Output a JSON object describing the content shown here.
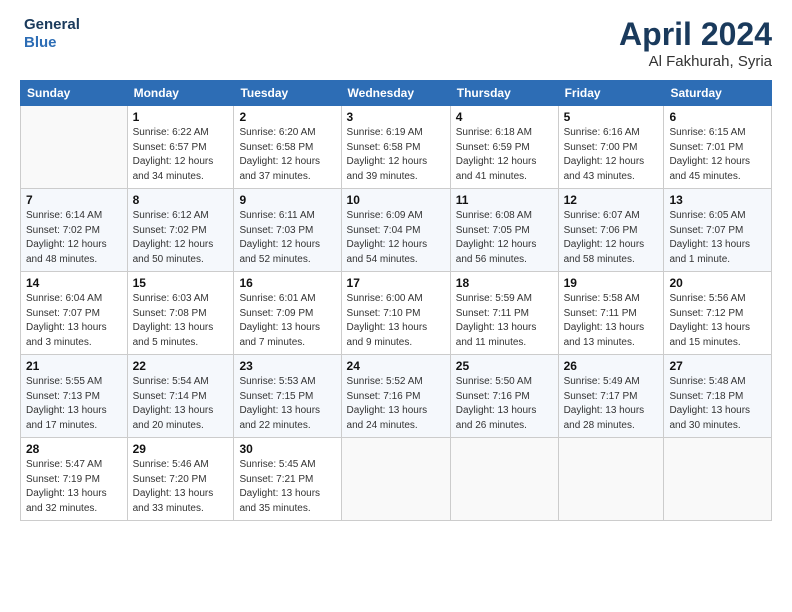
{
  "header": {
    "logo_line1": "General",
    "logo_line2": "Blue",
    "month_year": "April 2024",
    "location": "Al Fakhurah, Syria"
  },
  "columns": [
    "Sunday",
    "Monday",
    "Tuesday",
    "Wednesday",
    "Thursday",
    "Friday",
    "Saturday"
  ],
  "weeks": [
    [
      {
        "num": "",
        "info": ""
      },
      {
        "num": "1",
        "info": "Sunrise: 6:22 AM\nSunset: 6:57 PM\nDaylight: 12 hours\nand 34 minutes."
      },
      {
        "num": "2",
        "info": "Sunrise: 6:20 AM\nSunset: 6:58 PM\nDaylight: 12 hours\nand 37 minutes."
      },
      {
        "num": "3",
        "info": "Sunrise: 6:19 AM\nSunset: 6:58 PM\nDaylight: 12 hours\nand 39 minutes."
      },
      {
        "num": "4",
        "info": "Sunrise: 6:18 AM\nSunset: 6:59 PM\nDaylight: 12 hours\nand 41 minutes."
      },
      {
        "num": "5",
        "info": "Sunrise: 6:16 AM\nSunset: 7:00 PM\nDaylight: 12 hours\nand 43 minutes."
      },
      {
        "num": "6",
        "info": "Sunrise: 6:15 AM\nSunset: 7:01 PM\nDaylight: 12 hours\nand 45 minutes."
      }
    ],
    [
      {
        "num": "7",
        "info": "Sunrise: 6:14 AM\nSunset: 7:02 PM\nDaylight: 12 hours\nand 48 minutes."
      },
      {
        "num": "8",
        "info": "Sunrise: 6:12 AM\nSunset: 7:02 PM\nDaylight: 12 hours\nand 50 minutes."
      },
      {
        "num": "9",
        "info": "Sunrise: 6:11 AM\nSunset: 7:03 PM\nDaylight: 12 hours\nand 52 minutes."
      },
      {
        "num": "10",
        "info": "Sunrise: 6:09 AM\nSunset: 7:04 PM\nDaylight: 12 hours\nand 54 minutes."
      },
      {
        "num": "11",
        "info": "Sunrise: 6:08 AM\nSunset: 7:05 PM\nDaylight: 12 hours\nand 56 minutes."
      },
      {
        "num": "12",
        "info": "Sunrise: 6:07 AM\nSunset: 7:06 PM\nDaylight: 12 hours\nand 58 minutes."
      },
      {
        "num": "13",
        "info": "Sunrise: 6:05 AM\nSunset: 7:07 PM\nDaylight: 13 hours\nand 1 minute."
      }
    ],
    [
      {
        "num": "14",
        "info": "Sunrise: 6:04 AM\nSunset: 7:07 PM\nDaylight: 13 hours\nand 3 minutes."
      },
      {
        "num": "15",
        "info": "Sunrise: 6:03 AM\nSunset: 7:08 PM\nDaylight: 13 hours\nand 5 minutes."
      },
      {
        "num": "16",
        "info": "Sunrise: 6:01 AM\nSunset: 7:09 PM\nDaylight: 13 hours\nand 7 minutes."
      },
      {
        "num": "17",
        "info": "Sunrise: 6:00 AM\nSunset: 7:10 PM\nDaylight: 13 hours\nand 9 minutes."
      },
      {
        "num": "18",
        "info": "Sunrise: 5:59 AM\nSunset: 7:11 PM\nDaylight: 13 hours\nand 11 minutes."
      },
      {
        "num": "19",
        "info": "Sunrise: 5:58 AM\nSunset: 7:11 PM\nDaylight: 13 hours\nand 13 minutes."
      },
      {
        "num": "20",
        "info": "Sunrise: 5:56 AM\nSunset: 7:12 PM\nDaylight: 13 hours\nand 15 minutes."
      }
    ],
    [
      {
        "num": "21",
        "info": "Sunrise: 5:55 AM\nSunset: 7:13 PM\nDaylight: 13 hours\nand 17 minutes."
      },
      {
        "num": "22",
        "info": "Sunrise: 5:54 AM\nSunset: 7:14 PM\nDaylight: 13 hours\nand 20 minutes."
      },
      {
        "num": "23",
        "info": "Sunrise: 5:53 AM\nSunset: 7:15 PM\nDaylight: 13 hours\nand 22 minutes."
      },
      {
        "num": "24",
        "info": "Sunrise: 5:52 AM\nSunset: 7:16 PM\nDaylight: 13 hours\nand 24 minutes."
      },
      {
        "num": "25",
        "info": "Sunrise: 5:50 AM\nSunset: 7:16 PM\nDaylight: 13 hours\nand 26 minutes."
      },
      {
        "num": "26",
        "info": "Sunrise: 5:49 AM\nSunset: 7:17 PM\nDaylight: 13 hours\nand 28 minutes."
      },
      {
        "num": "27",
        "info": "Sunrise: 5:48 AM\nSunset: 7:18 PM\nDaylight: 13 hours\nand 30 minutes."
      }
    ],
    [
      {
        "num": "28",
        "info": "Sunrise: 5:47 AM\nSunset: 7:19 PM\nDaylight: 13 hours\nand 32 minutes."
      },
      {
        "num": "29",
        "info": "Sunrise: 5:46 AM\nSunset: 7:20 PM\nDaylight: 13 hours\nand 33 minutes."
      },
      {
        "num": "30",
        "info": "Sunrise: 5:45 AM\nSunset: 7:21 PM\nDaylight: 13 hours\nand 35 minutes."
      },
      {
        "num": "",
        "info": ""
      },
      {
        "num": "",
        "info": ""
      },
      {
        "num": "",
        "info": ""
      },
      {
        "num": "",
        "info": ""
      }
    ]
  ]
}
